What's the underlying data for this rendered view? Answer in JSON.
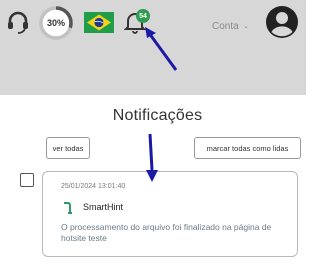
{
  "header": {
    "progress_percent": 30,
    "progress_label": "30%",
    "language_flag": "brazil-flag-icon",
    "notification_count": "54",
    "account_label": "Conta",
    "colors": {
      "background": "#d7d7d7",
      "badge": "#2e9b4f",
      "progress": "#555555"
    }
  },
  "notifications": {
    "title": "Notificações",
    "view_all_label": "ver todas",
    "mark_all_label": "marcar todas como lidas",
    "items": [
      {
        "timestamp": "25/01/2024 13:01:40",
        "sender": "SmartHint",
        "sender_icon": "smarthint-logo-icon",
        "message": "O processamento do arquivo foi finalizado na página de hotsite teste"
      }
    ]
  },
  "annotations": {
    "arrow_color": "#1a1aa6"
  }
}
